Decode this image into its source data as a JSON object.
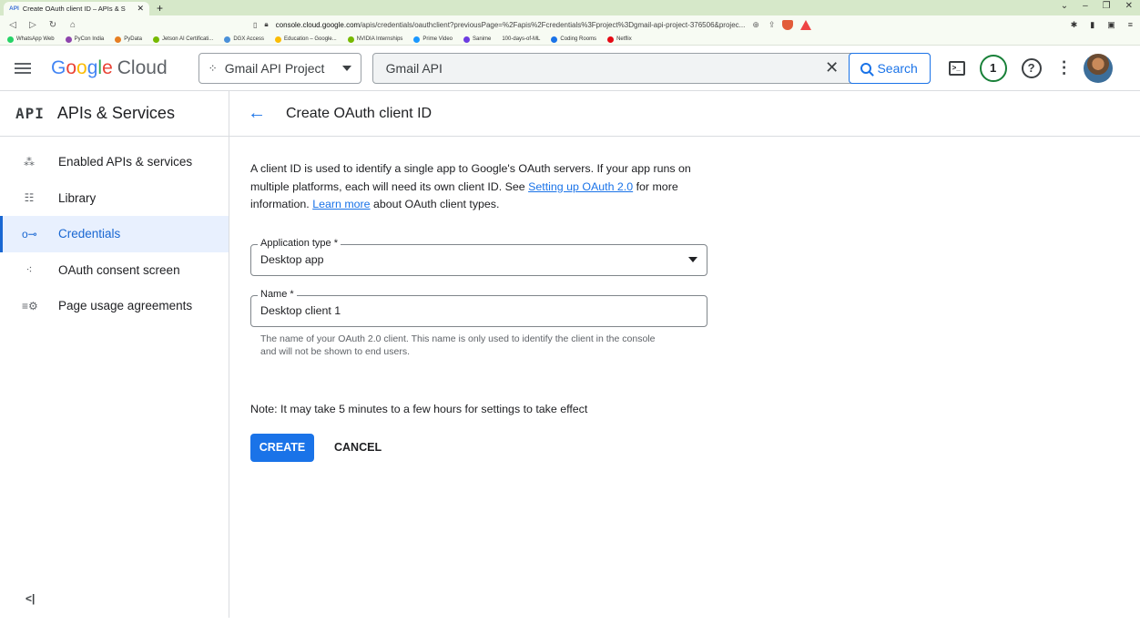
{
  "browser": {
    "tab_icon": "API",
    "tab_title": "Create OAuth client ID – APIs & S",
    "url_host": "console.cloud.google.com",
    "url_path": "/apis/credentials/oauthclient?previousPage=%2Fapis%2Fcredentials%3Fproject%3Dgmail-api-project-376506&projec...",
    "bookmarks": [
      "WhatsApp Web",
      "PyCon India",
      "PyData",
      "Jetson AI Certificati...",
      "DGX Access",
      "Education – Google...",
      "NVIDIA Internships",
      "Prime Video",
      "Sanime",
      "100-days-of-ML",
      "Coding Rooms",
      "Netflix"
    ]
  },
  "header": {
    "logo_google": "Google",
    "logo_cloud": "Cloud",
    "project": "Gmail API Project",
    "search_value": "Gmail API",
    "search_button": "Search",
    "notification_count": "1"
  },
  "sidebar": {
    "badge": "API",
    "title": "APIs & Services",
    "items": [
      {
        "label": "Enabled APIs & services",
        "icon": "enabled-apis-icon"
      },
      {
        "label": "Library",
        "icon": "library-icon"
      },
      {
        "label": "Credentials",
        "icon": "key-icon",
        "active": true
      },
      {
        "label": "OAuth consent screen",
        "icon": "consent-icon"
      },
      {
        "label": "Page usage agreements",
        "icon": "settings-list-icon"
      }
    ]
  },
  "main": {
    "title": "Create OAuth client ID",
    "desc_part1": "A client ID is used to identify a single app to Google's OAuth servers. If your app runs on multiple platforms, each will need its own client ID. See ",
    "desc_link1": "Setting up OAuth 2.0",
    "desc_part2": " for more information. ",
    "desc_link2": "Learn more",
    "desc_part3": " about OAuth client types.",
    "app_type_label": "Application type *",
    "app_type_value": "Desktop app",
    "name_label": "Name *",
    "name_value": "Desktop client 1",
    "name_hint": "The name of your OAuth 2.0 client. This name is only used to identify the client in the console and will not be shown to end users.",
    "note": "Note: It may take 5 minutes to a few hours for settings to take effect",
    "create_label": "CREATE",
    "cancel_label": "CANCEL"
  },
  "colors": {
    "accent": "#1a73e8",
    "active_bg": "#e8f0fe",
    "tabbar": "#d6e8c9"
  }
}
